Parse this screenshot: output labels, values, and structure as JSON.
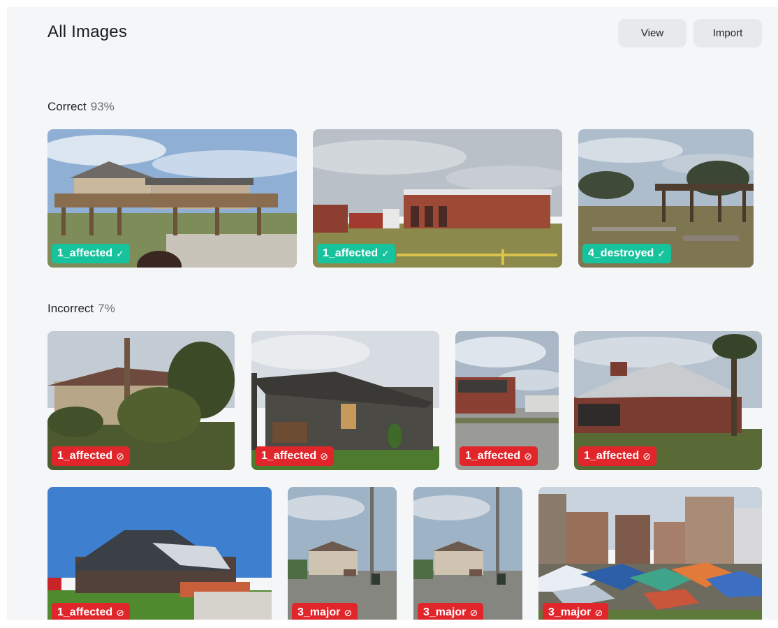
{
  "header": {
    "title": "All Images",
    "view_label": "View",
    "import_label": "Import"
  },
  "sections": {
    "correct": {
      "label": "Correct",
      "percent": "93%"
    },
    "incorrect": {
      "label": "Incorrect",
      "percent": "7%"
    }
  },
  "icons": {
    "correct_mark": "check-icon",
    "incorrect_mark": "prohibited-icon"
  },
  "colors": {
    "correct_badge": "#17c39d",
    "incorrect_badge": "#e0262b"
  },
  "correct_images": [
    {
      "label": "1_affected",
      "mark": "✓"
    },
    {
      "label": "1_affected",
      "mark": "✓"
    },
    {
      "label": "4_destroyed",
      "mark": "✓"
    }
  ],
  "incorrect_images": [
    {
      "label": "1_affected",
      "mark": "⊘"
    },
    {
      "label": "1_affected",
      "mark": "⊘"
    },
    {
      "label": "1_affected",
      "mark": "⊘"
    },
    {
      "label": "1_affected",
      "mark": "⊘"
    },
    {
      "label": "1_affected",
      "mark": "⊘"
    },
    {
      "label": "3_major",
      "mark": "⊘"
    },
    {
      "label": "3_major",
      "mark": "⊘"
    },
    {
      "label": "3_major",
      "mark": "⊘"
    }
  ]
}
